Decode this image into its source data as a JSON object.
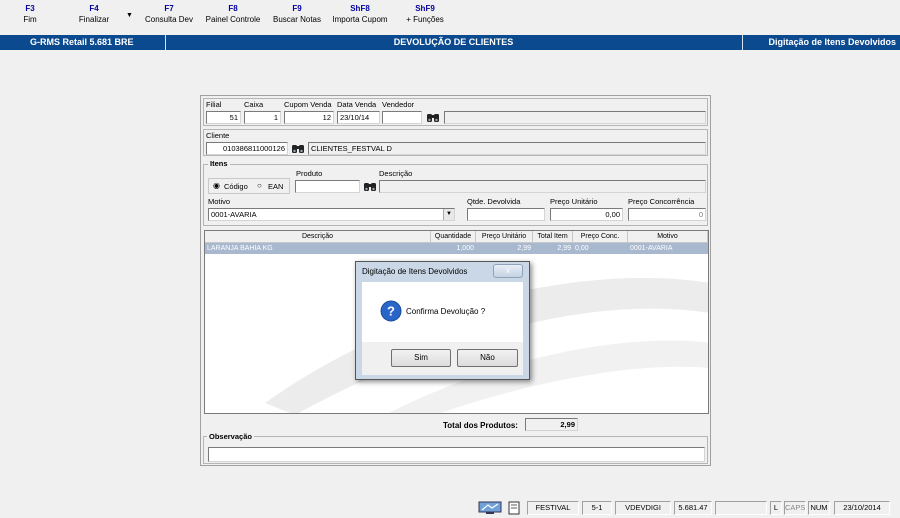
{
  "toolbar": {
    "keys": [
      {
        "key": "F3",
        "label": "Fim"
      },
      {
        "key": "F4",
        "label": "Finalizar"
      },
      {
        "key": "F7",
        "label": "Consulta Dev"
      },
      {
        "key": "F8",
        "label": "Painel Controle"
      },
      {
        "key": "F9",
        "label": "Buscar Notas"
      },
      {
        "key": "ShF8",
        "label": "Importa Cupom"
      },
      {
        "key": "ShF9",
        "label": "+ Funções"
      }
    ]
  },
  "titlebar": {
    "app": "G-RMS Retail 5.681 BRE",
    "module": "DEVOLUÇÃO DE CLIENTES",
    "screen": "Digitação de Itens Devolvidos"
  },
  "header": {
    "filial_label": "Filial",
    "filial_value": "51",
    "caixa_label": "Caixa",
    "caixa_value": "1",
    "cupom_label": "Cupom Venda",
    "cupom_value": "12",
    "data_label": "Data Venda",
    "data_value": "23/10/14",
    "vendedor_label": "Vendedor",
    "vendedor_value": "",
    "vendedor_name": ""
  },
  "cliente": {
    "label": "Cliente",
    "code": "010386811000126",
    "name": "CLIENTES_FESTVAL D"
  },
  "itens": {
    "group_label": "Itens",
    "radio_codigo": "Código",
    "radio_ean": "EAN",
    "produto_label": "Produto",
    "produto_value": "",
    "descricao_label": "Descrição",
    "descricao_value": "",
    "motivo_label": "Motivo",
    "motivo_value": "0001-AVARIA",
    "qtde_label": "Qtde. Devolvida",
    "qtde_value": "",
    "preco_unit_label": "Preço Unitário",
    "preco_unit_value": "0,00",
    "preco_conc_label": "Preço Concorrência",
    "preco_conc_value": "0"
  },
  "grid": {
    "columns": [
      "Descrição",
      "Quantidade",
      "Preço Unitário",
      "Total Item",
      "Preço Conc.",
      "Motivo"
    ],
    "rows": [
      [
        "LARANJA BAHIA KG",
        "1,000",
        "2,99",
        "2,99",
        "0,00",
        "0001-AVARIA"
      ]
    ]
  },
  "totals": {
    "label": "Total dos Produtos:",
    "value": "2,99"
  },
  "observacao": {
    "label": "Observação",
    "value": ""
  },
  "dialog": {
    "title": "Digitação de Itens Devolvidos",
    "close": "x",
    "message": "Confirma Devolução ?",
    "yes": "Sim",
    "no": "Não"
  },
  "status": {
    "user": "FESTIVAL",
    "loja": "5-1",
    "program": "VDEVDIGI",
    "version": "5.681.47",
    "blank": "",
    "l": "L",
    "caps": "CAPS",
    "num": "NUM",
    "date": "23/10/2014"
  },
  "colors": {
    "titlebar": "#0b4a8f",
    "fkey": "#0000a0",
    "selected_row": "#a8b8cf",
    "question_icon": "#2a66c8"
  }
}
